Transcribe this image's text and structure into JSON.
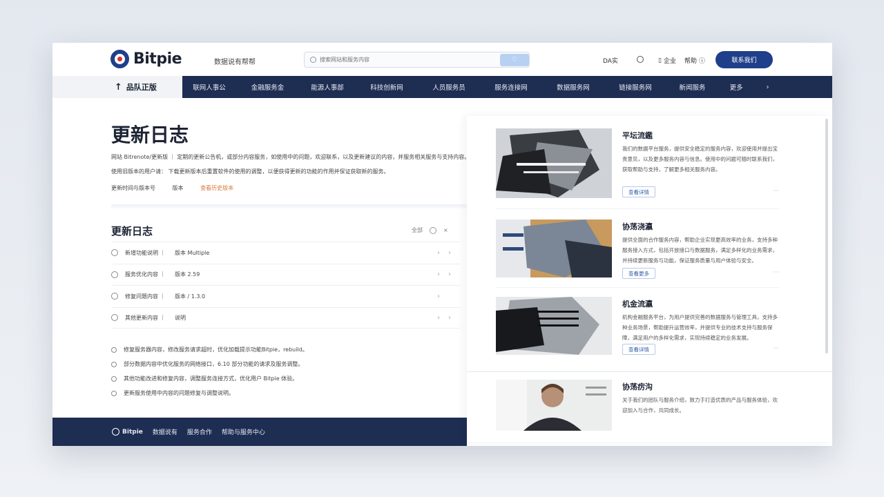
{
  "header": {
    "logo_text": "Bitpie",
    "tagline": "数据说有帮帮",
    "search_placeholder": "搜索网站和服务内容",
    "search_button": "♡",
    "item_1": "DA实",
    "item_2": "企业",
    "item_3": "帮助",
    "cta_label": "联系我们"
  },
  "nav": {
    "home_label": "品队正版",
    "items": [
      "联网人事公",
      "金融服务金",
      "能源人事部",
      "科技创新网",
      "人员服务员",
      "服务连接网",
      "数据服务网",
      "链接服务网",
      "新闻服务"
    ],
    "last_item": "更多"
  },
  "hero": {
    "title": "更新日志",
    "line_1": "网站 Bitrenote/更新版 ｜ 定期的更新公告机，或部分内容服务，如使用中的问题，欢迎联系，以及更新建议的内容，并服务相关服务与支持内容。",
    "line_2": "使用旧版本的用户请：  下载更新版本后重置软件的使用的调整，以便获得更新的功能的作用并保证获取新的服务。",
    "line_3_text": "更新时间与版本号",
    "line_3_date": "版本",
    "line_3_link": "查看历史版本"
  },
  "changelog": {
    "title": "更新日志",
    "tool_label": "全部",
    "rows": [
      {
        "c1": "新增功能说明 ｜",
        "c2": "版本 Multiple"
      },
      {
        "c1": "服务优化内容 ｜",
        "c2": "版本 2.59"
      },
      {
        "c1": "修复问题内容 ｜",
        "c2": "版本 / 1.3.0"
      },
      {
        "c1": "其他更新内容 ｜",
        "c2": "说明"
      }
    ],
    "notes": [
      "修复服务器内容，修改服务请求超时，优化加载提示功能Bitpie，rebuild。",
      "部分数据内容中优化服务的网络接口，6.10 部分功能的请求及服务调整。",
      "其他功能改进和修复内容，调整服务连接方式，优化用户 Bitpie 体验。",
      "更新服务使用中内容的问题修复与调整说明。"
    ]
  },
  "footer": {
    "logo_text": "Bitpie",
    "link_1": "数据说有",
    "link_2": "服务合作",
    "link_3": "帮助与服务中心"
  },
  "cards": [
    {
      "title": "平坛流鑑",
      "desc": "我们的数据平台服务，提供安全稳定的服务内容，欢迎使用并提出宝贵意见，以及更多服务内容与信息。使用中的问题可随时联系我们，获取帮助与支持，了解更多相关服务内容。",
      "button": "查看详情"
    },
    {
      "title": "协荡浇瀛",
      "desc": "提供全面的合作服务内容，帮助企业实现更高效率的业务，支持多种服务接入方式，包括开放接口与数据服务，满足多样化的业务需求，并持续更新服务与功能，保证服务质量与用户体验与安全。",
      "button": "查看更多"
    },
    {
      "title": "机金流瀛",
      "desc": "机构金融服务平台，为用户提供完善的数据服务与管理工具，支持多种业务场景，帮助提升运营效率，并提供专业的技术支持与服务保障，满足用户的多样化需求，实现持续稳定的业务发展。",
      "button": "查看详情"
    },
    {
      "title": "协荡疠沟",
      "desc": "关于我们的团队与服务介绍，致力于打造优质的产品与服务体验，欢迎加入与合作，共同成长。",
      "button": ""
    }
  ]
}
